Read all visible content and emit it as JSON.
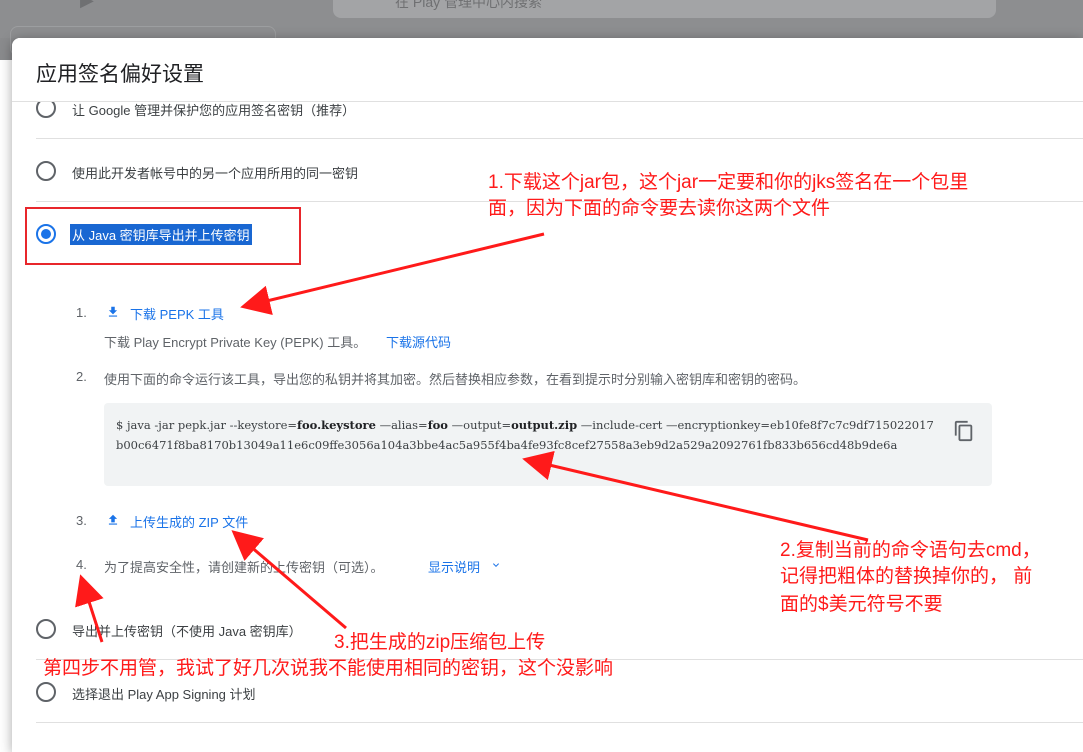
{
  "background": {
    "search_placeholder": "在 Play 管理中心内搜索"
  },
  "dialog": {
    "title": "应用签名偏好设置",
    "options": [
      "让 Google 管理并保护您的应用签名密钥（推荐）",
      "使用此开发者帐号中的另一个应用所用的同一密钥",
      "从 Java 密钥库导出并上传密钥",
      "导出并上传密钥（不使用 Java 密钥库）",
      "选择退出 Play App Signing 计划"
    ],
    "steps": {
      "s1_num": "1.",
      "s1_link": "下载 PEPK 工具",
      "s1_desc": "下载 Play Encrypt Private Key (PEPK) 工具。",
      "s1_source_link": "下载源代码",
      "s2_num": "2.",
      "s2_desc": "使用下面的命令运行该工具，导出您的私钥并将其加密。然后替换相应参数，在看到提示时分别输入密钥库和密钥的密码。",
      "s3_num": "3.",
      "s3_link": "上传生成的 ZIP 文件",
      "s4_num": "4.",
      "s4_desc": "为了提高安全性，请创建新的上传密钥（可选）。",
      "s4_link": "显示说明"
    },
    "command": {
      "p1": "$ java -jar pepk.jar --keystore=",
      "b1": "foo.keystore",
      "p2": " —alias=",
      "b2": "foo",
      "p3": " —output=",
      "b3": "output.zip",
      "p4": " —include-cert —encryptionkey=eb10fe8f7c7c9df715022017b00c6471f8ba8170b13049a11e6c09ffe3056a104a3bbe4ac5a955f4ba4fe93fc8cef27558a3eb9d2a529a2092761fb833b656cd48b9de6a"
    }
  },
  "annotations": {
    "a1_line1": "1.下载这个jar包，这个jar一定要和你的jks签名在一个包里",
    "a1_line2": "面，因为下面的命令要去读你这两个文件",
    "a2_line1": "2.复制当前的命令语句去cmd，",
    "a2_line2": "记得把粗体的替换掉你的， 前",
    "a2_line3": "面的$美元符号不要",
    "a3": "3.把生成的zip压缩包上传",
    "a4": "第四步不用管，我试了好几次说我不能使用相同的密钥，这个没影响",
    "color": "#ff1a1a"
  }
}
